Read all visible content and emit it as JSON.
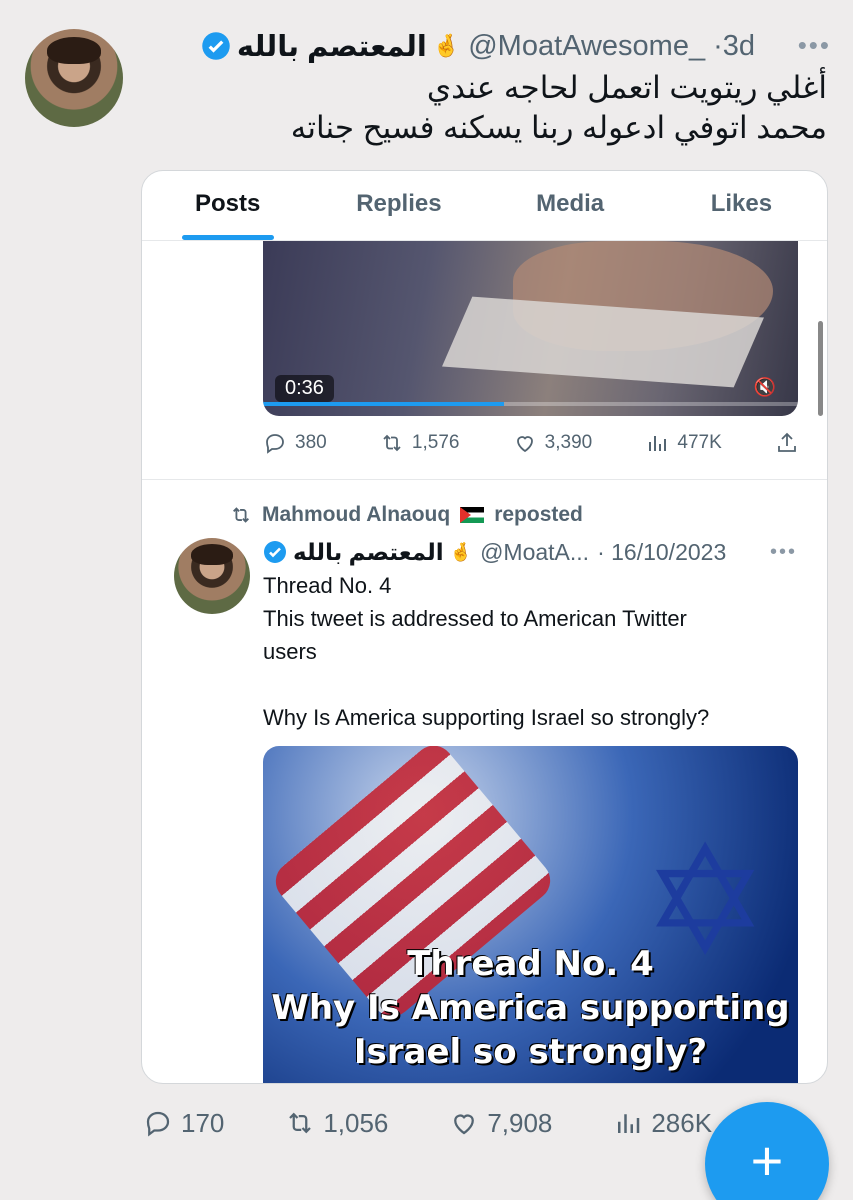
{
  "tweet": {
    "author_name": "المعتصم بالله",
    "author_emoji": "🤞",
    "handle": "@MoatAwesome_",
    "time": "·3d",
    "text_line1": "أغلي ريتويت اتعمل لحاجه عندي",
    "text_line2": "محمد اتوفي ادعوله ربنا يسكنه فسيح جناته",
    "stats": {
      "replies": "170",
      "reposts": "1,056",
      "likes": "7,908",
      "views": "286K"
    }
  },
  "embedded": {
    "tabs": [
      "Posts",
      "Replies",
      "Media",
      "Likes"
    ],
    "video": {
      "time": "0:36",
      "progress": 0.45
    },
    "video_stats": {
      "replies": "380",
      "reposts": "1,576",
      "likes": "3,390",
      "views": "477K"
    },
    "repost": {
      "by": "Mahmoud Alnaouq",
      "label": "reposted"
    },
    "post": {
      "author_name": "المعتصم بالله",
      "author_emoji": "🤞",
      "handle": "@MoatA...",
      "date": "· 16/10/2023",
      "line1": "Thread No. 4",
      "line2": "This tweet is addressed to American Twitter",
      "line3": "users",
      "line4": "Why Is America supporting Israel so strongly?"
    },
    "image_caption": {
      "line1": "Thread No. 4",
      "line2": "Why Is America supporting",
      "line3": "Israel so strongly?"
    }
  },
  "colors": {
    "accent": "#1d9bf0",
    "text": "#0f1419",
    "muted": "#536471"
  }
}
